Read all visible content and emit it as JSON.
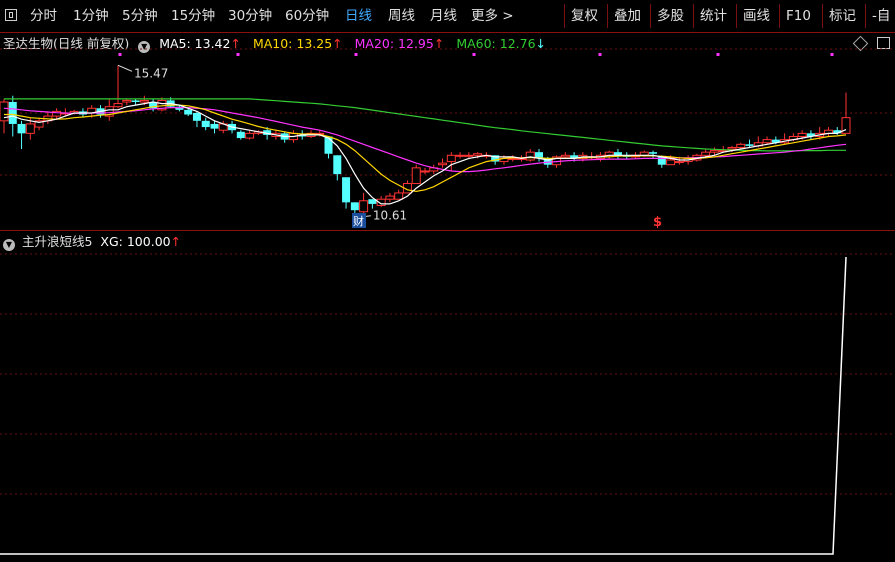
{
  "toolbar": {
    "periods": [
      {
        "label": "分时",
        "name": "tab-intraday"
      },
      {
        "label": "1分钟",
        "name": "tab-1min"
      },
      {
        "label": "5分钟",
        "name": "tab-5min"
      },
      {
        "label": "15分钟",
        "name": "tab-15min"
      },
      {
        "label": "30分钟",
        "name": "tab-30min"
      },
      {
        "label": "60分钟",
        "name": "tab-60min"
      },
      {
        "label": "日线",
        "name": "tab-daily"
      },
      {
        "label": "周线",
        "name": "tab-weekly"
      },
      {
        "label": "月线",
        "name": "tab-monthly"
      },
      {
        "label": "更多 >",
        "name": "tab-more"
      }
    ],
    "active_period": "日线",
    "right_buttons": [
      {
        "label": "复权",
        "name": "adjust-button"
      },
      {
        "label": "叠加",
        "name": "overlay-button"
      },
      {
        "label": "多股",
        "name": "multi-stock-button"
      },
      {
        "label": "统计",
        "name": "statistics-button"
      },
      {
        "label": "画线",
        "name": "draw-line-button"
      },
      {
        "label": "F10",
        "name": "f10-button"
      },
      {
        "label": "标记",
        "name": "mark-button"
      },
      {
        "label": "-自",
        "name": "custom-button"
      }
    ]
  },
  "main_header": {
    "stock": "圣达生物(日线 前复权)",
    "ma5": {
      "label": "MA5: 13.42",
      "arrow": "↑",
      "color": "#ffffff"
    },
    "ma10": {
      "label": "MA10: 13.25",
      "arrow": "↑",
      "color": "#ffd700"
    },
    "ma20": {
      "label": "MA20: 12.95",
      "arrow": "↑",
      "color": "#ff33ff"
    },
    "ma60": {
      "label": "MA60: 12.76",
      "arrow": "↓",
      "color": "#33cc33"
    }
  },
  "annotations": {
    "high": "15.47",
    "low": "10.61",
    "finance_marker": "财",
    "dollar_marker": "$"
  },
  "indicator_header": {
    "name": "主升浪短线5",
    "xg": "XG: 100.00",
    "arrow": "↑"
  },
  "colors": {
    "up": "#ff3333",
    "down": "#54ffff",
    "grid": "#6a0f0f",
    "indicator_line": "#ffffff"
  },
  "chart_data": {
    "type": "candlestick",
    "price_range": [
      10.61,
      15.47
    ],
    "candles": [
      [
        13.7,
        14.3,
        14.4,
        13.3
      ],
      [
        14.3,
        13.6,
        14.5,
        13.2
      ],
      [
        13.6,
        13.3,
        13.7,
        12.8
      ],
      [
        13.3,
        13.6,
        13.8,
        13.1
      ],
      [
        13.5,
        13.7,
        13.8,
        13.4
      ],
      [
        13.7,
        13.85,
        14.0,
        13.6
      ],
      [
        13.85,
        14.0,
        14.1,
        13.75
      ],
      [
        13.95,
        13.95,
        14.1,
        13.85
      ],
      [
        13.95,
        14.0,
        14.05,
        13.9
      ],
      [
        14.0,
        13.9,
        14.1,
        13.8
      ],
      [
        13.95,
        14.1,
        14.2,
        13.8
      ],
      [
        14.1,
        13.9,
        14.2,
        13.8
      ],
      [
        13.85,
        14.15,
        14.4,
        13.7
      ],
      [
        14.15,
        14.25,
        15.47,
        14.1
      ],
      [
        14.3,
        14.35,
        14.4,
        14.2
      ],
      [
        14.35,
        14.3,
        14.4,
        14.2
      ],
      [
        14.3,
        14.35,
        14.5,
        14.2
      ],
      [
        14.3,
        14.1,
        14.4,
        14.0
      ],
      [
        14.05,
        14.35,
        14.45,
        14.0
      ],
      [
        14.35,
        14.15,
        14.45,
        14.1
      ],
      [
        14.15,
        14.05,
        14.2,
        14.0
      ],
      [
        14.05,
        13.9,
        14.1,
        13.85
      ],
      [
        13.95,
        13.7,
        14.0,
        13.5
      ],
      [
        13.7,
        13.5,
        13.8,
        13.4
      ],
      [
        13.6,
        13.45,
        13.7,
        13.3
      ],
      [
        13.4,
        13.6,
        13.7,
        13.3
      ],
      [
        13.6,
        13.4,
        13.7,
        13.3
      ],
      [
        13.35,
        13.15,
        13.4,
        13.1
      ],
      [
        13.15,
        13.3,
        13.4,
        13.1
      ],
      [
        13.3,
        13.35,
        13.4,
        13.25
      ],
      [
        13.4,
        13.25,
        13.5,
        13.1
      ],
      [
        13.2,
        13.3,
        13.4,
        13.1
      ],
      [
        13.3,
        13.1,
        13.35,
        13.0
      ],
      [
        13.1,
        13.3,
        13.4,
        13.0
      ],
      [
        13.25,
        13.2,
        13.4,
        13.1
      ],
      [
        13.2,
        13.3,
        13.4,
        13.15
      ],
      [
        13.3,
        13.3,
        13.4,
        13.2
      ],
      [
        13.2,
        12.65,
        13.2,
        12.5
      ],
      [
        12.6,
        12.0,
        12.6,
        11.8
      ],
      [
        11.9,
        11.1,
        11.9,
        10.9
      ],
      [
        11.1,
        10.85,
        11.1,
        10.61
      ],
      [
        10.8,
        11.15,
        11.4,
        10.7
      ],
      [
        11.2,
        11.05,
        11.2,
        10.9
      ],
      [
        11.0,
        11.2,
        11.3,
        10.95
      ],
      [
        11.2,
        11.3,
        11.4,
        11.1
      ],
      [
        11.2,
        11.4,
        11.5,
        11.2
      ],
      [
        11.4,
        11.7,
        11.8,
        11.4
      ],
      [
        11.7,
        12.2,
        12.3,
        11.7
      ],
      [
        12.1,
        12.1,
        12.2,
        12.0
      ],
      [
        12.1,
        12.2,
        12.3,
        12.0
      ],
      [
        12.3,
        12.35,
        12.5,
        12.2
      ],
      [
        12.4,
        12.6,
        12.7,
        12.1
      ],
      [
        12.6,
        12.6,
        12.7,
        12.5
      ],
      [
        12.6,
        12.6,
        12.7,
        12.5
      ],
      [
        12.6,
        12.65,
        12.7,
        12.5
      ],
      [
        12.6,
        12.6,
        12.7,
        12.5
      ],
      [
        12.6,
        12.4,
        12.6,
        12.3
      ],
      [
        12.4,
        12.5,
        12.6,
        12.3
      ],
      [
        12.5,
        12.5,
        12.6,
        12.4
      ],
      [
        12.5,
        12.5,
        12.6,
        12.4
      ],
      [
        12.45,
        12.7,
        12.8,
        12.4
      ],
      [
        12.7,
        12.5,
        12.8,
        12.4
      ],
      [
        12.5,
        12.3,
        12.55,
        12.2
      ],
      [
        12.3,
        12.55,
        12.6,
        12.2
      ],
      [
        12.55,
        12.6,
        12.7,
        12.5
      ],
      [
        12.6,
        12.5,
        12.7,
        12.4
      ],
      [
        12.5,
        12.6,
        12.7,
        12.4
      ],
      [
        12.55,
        12.55,
        12.7,
        12.45
      ],
      [
        12.5,
        12.6,
        12.7,
        12.4
      ],
      [
        12.6,
        12.7,
        12.75,
        12.5
      ],
      [
        12.7,
        12.6,
        12.8,
        12.5
      ],
      [
        12.6,
        12.55,
        12.7,
        12.5
      ],
      [
        12.55,
        12.6,
        12.7,
        12.5
      ],
      [
        12.6,
        12.7,
        12.75,
        12.55
      ],
      [
        12.7,
        12.65,
        12.75,
        12.5
      ],
      [
        12.55,
        12.3,
        12.6,
        12.2
      ],
      [
        12.3,
        12.45,
        12.6,
        12.3
      ],
      [
        12.4,
        12.4,
        12.55,
        12.3
      ],
      [
        12.4,
        12.5,
        12.6,
        12.3
      ],
      [
        12.45,
        12.6,
        12.65,
        12.4
      ],
      [
        12.6,
        12.7,
        12.8,
        12.5
      ],
      [
        12.7,
        12.75,
        12.85,
        12.6
      ],
      [
        12.75,
        12.75,
        12.9,
        12.7
      ],
      [
        12.8,
        12.85,
        12.9,
        12.7
      ],
      [
        12.85,
        12.95,
        13.0,
        12.8
      ],
      [
        12.95,
        12.9,
        13.1,
        12.85
      ],
      [
        12.9,
        13.0,
        13.2,
        12.85
      ],
      [
        13.0,
        13.1,
        13.2,
        12.95
      ],
      [
        13.1,
        13.0,
        13.2,
        12.95
      ],
      [
        13.0,
        13.1,
        13.3,
        12.95
      ],
      [
        13.1,
        13.2,
        13.3,
        13.05
      ],
      [
        13.2,
        13.3,
        13.4,
        13.1
      ],
      [
        13.3,
        13.2,
        13.4,
        13.1
      ],
      [
        13.2,
        13.3,
        13.5,
        13.1
      ],
      [
        13.3,
        13.4,
        13.5,
        13.2
      ],
      [
        13.4,
        13.3,
        13.5,
        13.25
      ],
      [
        13.3,
        13.8,
        14.6,
        13.3
      ]
    ],
    "ma5": [
      13.8,
      13.85,
      13.75,
      13.7,
      13.65,
      13.7,
      13.75,
      13.85,
      13.95,
      13.95,
      13.95,
      14.0,
      14.05,
      14.05,
      14.15,
      14.2,
      14.25,
      14.3,
      14.25,
      14.25,
      14.2,
      14.1,
      14.0,
      13.85,
      13.7,
      13.6,
      13.5,
      13.45,
      13.4,
      13.35,
      13.3,
      13.25,
      13.2,
      13.2,
      13.25,
      13.25,
      13.25,
      13.15,
      12.9,
      12.5,
      12.0,
      11.55,
      11.25,
      11.05,
      11.05,
      11.15,
      11.3,
      11.55,
      11.75,
      11.95,
      12.1,
      12.3,
      12.4,
      12.5,
      12.55,
      12.6,
      12.55,
      12.55,
      12.55,
      12.5,
      12.55,
      12.5,
      12.45,
      12.5,
      12.5,
      12.5,
      12.55,
      12.55,
      12.55,
      12.6,
      12.6,
      12.6,
      12.6,
      12.6,
      12.6,
      12.55,
      12.5,
      12.45,
      12.45,
      12.5,
      12.55,
      12.6,
      12.7,
      12.75,
      12.8,
      12.85,
      12.9,
      12.95,
      13.0,
      13.05,
      13.1,
      13.15,
      13.2,
      13.25,
      13.3,
      13.3,
      13.42
    ],
    "ma10": [
      13.9,
      13.9,
      13.85,
      13.8,
      13.78,
      13.76,
      13.75,
      13.76,
      13.8,
      13.82,
      13.85,
      13.88,
      13.9,
      13.95,
      14.0,
      14.05,
      14.1,
      14.15,
      14.18,
      14.2,
      14.2,
      14.18,
      14.12,
      14.05,
      13.95,
      13.85,
      13.75,
      13.68,
      13.6,
      13.52,
      13.45,
      13.4,
      13.35,
      13.3,
      13.28,
      13.28,
      13.26,
      13.2,
      13.1,
      12.95,
      12.75,
      12.5,
      12.25,
      12.0,
      11.8,
      11.65,
      11.5,
      11.45,
      11.5,
      11.6,
      11.75,
      11.9,
      12.05,
      12.2,
      12.3,
      12.4,
      12.45,
      12.5,
      12.52,
      12.52,
      12.53,
      12.52,
      12.5,
      12.5,
      12.5,
      12.5,
      12.52,
      12.53,
      12.55,
      12.55,
      12.57,
      12.58,
      12.58,
      12.58,
      12.58,
      12.57,
      12.55,
      12.52,
      12.5,
      12.5,
      12.52,
      12.55,
      12.6,
      12.65,
      12.7,
      12.75,
      12.8,
      12.85,
      12.9,
      12.95,
      13.0,
      13.05,
      13.1,
      13.15,
      13.2,
      13.22,
      13.25
    ],
    "ma20": [
      14.1,
      14.08,
      14.05,
      14.02,
      14.0,
      13.98,
      13.96,
      13.95,
      13.94,
      13.94,
      13.95,
      13.95,
      13.96,
      13.98,
      14.0,
      14.02,
      14.05,
      14.08,
      14.1,
      14.12,
      14.12,
      14.12,
      14.1,
      14.08,
      14.05,
      14.0,
      13.95,
      13.9,
      13.85,
      13.8,
      13.74,
      13.68,
      13.62,
      13.56,
      13.5,
      13.45,
      13.4,
      13.33,
      13.25,
      13.15,
      13.05,
      12.95,
      12.85,
      12.75,
      12.65,
      12.55,
      12.45,
      12.35,
      12.27,
      12.2,
      12.15,
      12.1,
      12.08,
      12.08,
      12.1,
      12.13,
      12.17,
      12.2,
      12.24,
      12.28,
      12.32,
      12.35,
      12.38,
      12.4,
      12.42,
      12.44,
      12.45,
      12.46,
      12.47,
      12.48,
      12.48,
      12.48,
      12.49,
      12.5,
      12.5,
      12.5,
      12.51,
      12.52,
      12.52,
      12.53,
      12.54,
      12.55,
      12.56,
      12.58,
      12.6,
      12.62,
      12.64,
      12.66,
      12.68,
      12.7,
      12.73,
      12.76,
      12.8,
      12.84,
      12.88,
      12.92,
      12.95
    ],
    "ma60": [
      14.4,
      14.4,
      14.4,
      14.4,
      14.4,
      14.4,
      14.4,
      14.4,
      14.4,
      14.4,
      14.4,
      14.4,
      14.4,
      14.4,
      14.4,
      14.4,
      14.4,
      14.4,
      14.4,
      14.4,
      14.4,
      14.4,
      14.4,
      14.4,
      14.4,
      14.4,
      14.4,
      14.4,
      14.4,
      14.38,
      14.36,
      14.34,
      14.32,
      14.3,
      14.28,
      14.26,
      14.24,
      14.21,
      14.18,
      14.15,
      14.12,
      14.08,
      14.04,
      14.0,
      13.96,
      13.92,
      13.88,
      13.84,
      13.8,
      13.76,
      13.72,
      13.68,
      13.64,
      13.6,
      13.56,
      13.52,
      13.48,
      13.45,
      13.42,
      13.38,
      13.35,
      13.32,
      13.29,
      13.26,
      13.23,
      13.2,
      13.17,
      13.14,
      13.11,
      13.08,
      13.05,
      13.02,
      12.99,
      12.96,
      12.93,
      12.9,
      12.88,
      12.86,
      12.84,
      12.82,
      12.8,
      12.79,
      12.78,
      12.77,
      12.76,
      12.75,
      12.75,
      12.74,
      12.74,
      12.74,
      12.74,
      12.75,
      12.75,
      12.75,
      12.76,
      12.76,
      12.76
    ],
    "indicator": {
      "name": "XG",
      "values_note": "flat",
      "last": 100.0
    }
  }
}
